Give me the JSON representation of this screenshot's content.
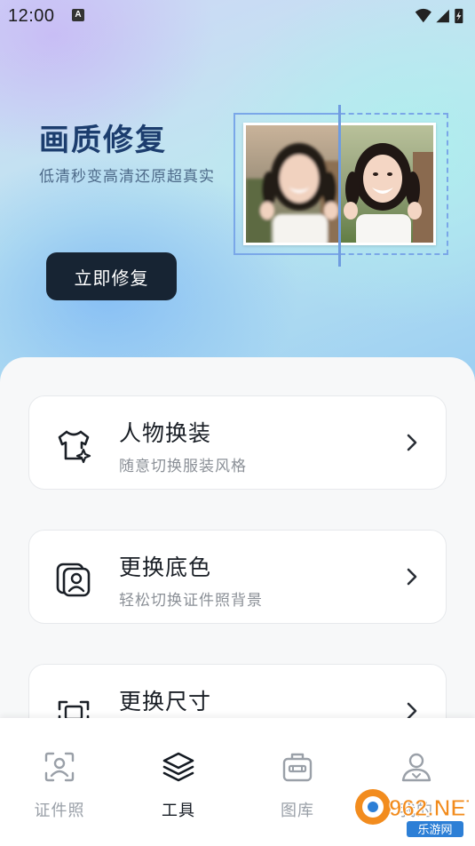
{
  "status_bar": {
    "time": "12:00",
    "notification_icon": "A"
  },
  "hero": {
    "title": "画质修复",
    "subtitle": "低清秒变高清还原超真实",
    "button_label": "立即修复",
    "illustration": "before-after-photo-compare"
  },
  "features": [
    {
      "title": "人物换装",
      "subtitle": "随意切换服装风格",
      "icon": "tshirt-sparkle-icon"
    },
    {
      "title": "更换底色",
      "subtitle": "轻松切换证件照背景",
      "icon": "id-photo-stack-icon"
    },
    {
      "title": "更换尺寸",
      "subtitle": "",
      "icon": "crop-frame-icon"
    }
  ],
  "tabbar": {
    "tabs": [
      {
        "label": "证件照",
        "icon": "face-scan-icon",
        "active": false
      },
      {
        "label": "工具",
        "icon": "layers-icon",
        "active": true
      },
      {
        "label": "图库",
        "icon": "toolbox-icon",
        "active": false
      },
      {
        "label": "我的",
        "icon": "user-profile-icon",
        "active": false
      }
    ]
  },
  "watermark": {
    "text": "962.NET",
    "subtext": "乐游网"
  },
  "colors": {
    "hero_title": "#1c3d6e",
    "button_bg": "#172433",
    "accent_frame": "#7aa7e8",
    "tab_active": "#141a22",
    "tab_inactive": "#9aa0a8"
  }
}
